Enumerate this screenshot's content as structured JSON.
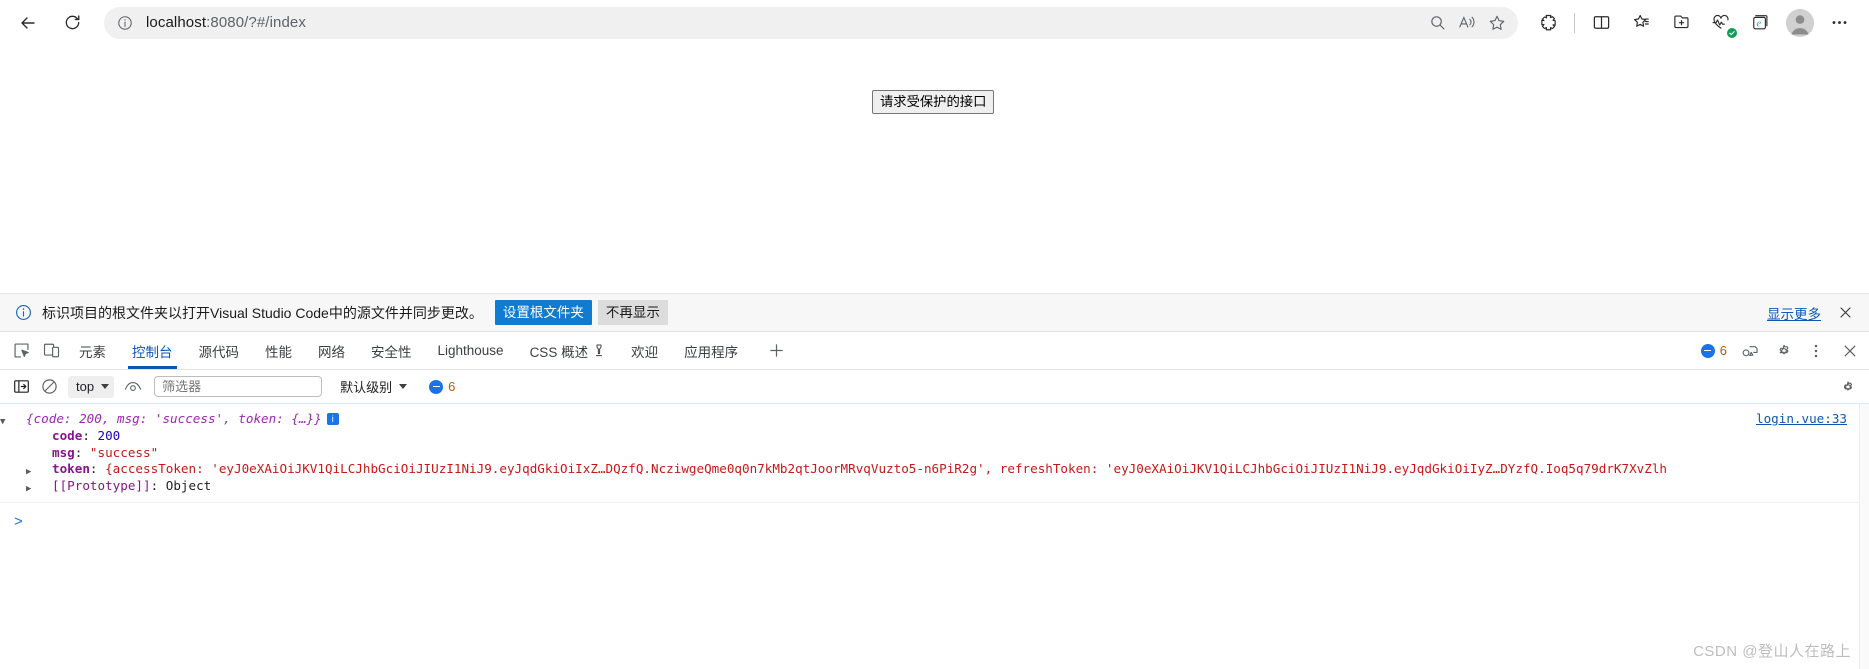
{
  "browser": {
    "back_label": "Back",
    "reload_label": "Refresh",
    "url_prefix": "localhost",
    "url_rest": ":8080/?#/index",
    "url_full": "localhost:8080/?#/index",
    "toolbar_icons": [
      {
        "name": "search-icon",
        "label": "Search in page"
      },
      {
        "name": "read-aloud-icon",
        "label": "Read aloud"
      },
      {
        "name": "favorite-star-icon",
        "label": "Add to favorites"
      },
      {
        "name": "extensions-icon",
        "label": "Extensions"
      },
      {
        "name": "split-screen-icon",
        "label": "Split screen"
      },
      {
        "name": "collections-icon",
        "label": "Collections"
      },
      {
        "name": "add-tab-group-icon",
        "label": "Add to tab group"
      },
      {
        "name": "performance-icon",
        "label": "Browser essentials"
      },
      {
        "name": "ie-mode-icon",
        "label": "Internet Explorer mode"
      },
      {
        "name": "profile-avatar-icon",
        "label": "Profile"
      },
      {
        "name": "settings-more-icon",
        "label": "Settings and more"
      }
    ]
  },
  "page": {
    "button_label": "请求受保护的接口"
  },
  "notification": {
    "message": "标识项目的根文件夹以打开Visual Studio Code中的源文件并同步更改。",
    "primary_button": "设置根文件夹",
    "secondary_button": "不再显示",
    "more_link": "显示更多",
    "close_label": "关闭"
  },
  "devtools": {
    "tabs": [
      {
        "label": "元素",
        "active": false
      },
      {
        "label": "控制台",
        "active": true
      },
      {
        "label": "源代码",
        "active": false
      },
      {
        "label": "性能",
        "active": false
      },
      {
        "label": "网络",
        "active": false
      },
      {
        "label": "安全性",
        "active": false
      },
      {
        "label": "Lighthouse",
        "active": false
      },
      {
        "label": "CSS 概述",
        "active": false,
        "icon": "wrench-icon"
      },
      {
        "label": "欢迎",
        "active": false
      },
      {
        "label": "应用程序",
        "active": false
      }
    ],
    "more_tabs_label": "+",
    "issues_count": "6",
    "header_icons": [
      {
        "name": "inspect-element-icon"
      },
      {
        "name": "device-toolbar-icon"
      },
      {
        "name": "customize-devtools-icon"
      },
      {
        "name": "devtools-settings-icon"
      },
      {
        "name": "devtools-more-icon"
      },
      {
        "name": "devtools-close-icon"
      }
    ],
    "console_toolbar": {
      "sidebar_toggle": "console-sidebar-icon",
      "clear_label": "清除控制台",
      "context": "top",
      "eye_label": "实时表达式",
      "filter_placeholder": "筛选器",
      "filter_value": "",
      "level": "默认级别",
      "issues_count": "6",
      "settings_label": "设置"
    },
    "console": {
      "source_link": "login.vue:33",
      "preview": "{code: 200, msg: 'success', token: {…}}",
      "rows": [
        {
          "indent": 0,
          "arrow": "down",
          "type": "preview",
          "text": "{code: 200, msg: 'success', token: {…}}",
          "badge": "i"
        },
        {
          "indent": 1,
          "arrow": "none",
          "type": "prop",
          "key": "code",
          "value": "200",
          "value_type": "number"
        },
        {
          "indent": 1,
          "arrow": "none",
          "type": "prop",
          "key": "msg",
          "value": "\"success\"",
          "value_type": "string"
        },
        {
          "indent": 1,
          "arrow": "right",
          "type": "prop",
          "key": "token",
          "value": "{accessToken: 'eyJ0eXAiOiJKV1QiLCJhbGciOiJIUzI1NiJ9.eyJqdGkiOiIxZ…DQzfQ.NcziwgeQme0q0n7kMb2qtJoorMRvqVuzto5-n6PiR2g', refreshToken: 'eyJ0eXAiOiJKV1QiLCJhbGciOiJIUzI1NiJ9.eyJqdGkiOiIyZ…DYzfQ.Ioq5q79drK7XvZlh",
          "value_type": "object"
        },
        {
          "indent": 1,
          "arrow": "right",
          "type": "proto",
          "key": "[[Prototype]]",
          "value": "Object",
          "value_type": "plain"
        }
      ]
    },
    "prompt_caret": ">"
  },
  "watermark": "CSDN @登山人在路上",
  "colors": {
    "accent": "#0b57b5",
    "notify_primary": "#0f7bd1",
    "string": "#c41a16",
    "number": "#1c00cf",
    "key": "#881391",
    "preview": "#9c27b0"
  }
}
